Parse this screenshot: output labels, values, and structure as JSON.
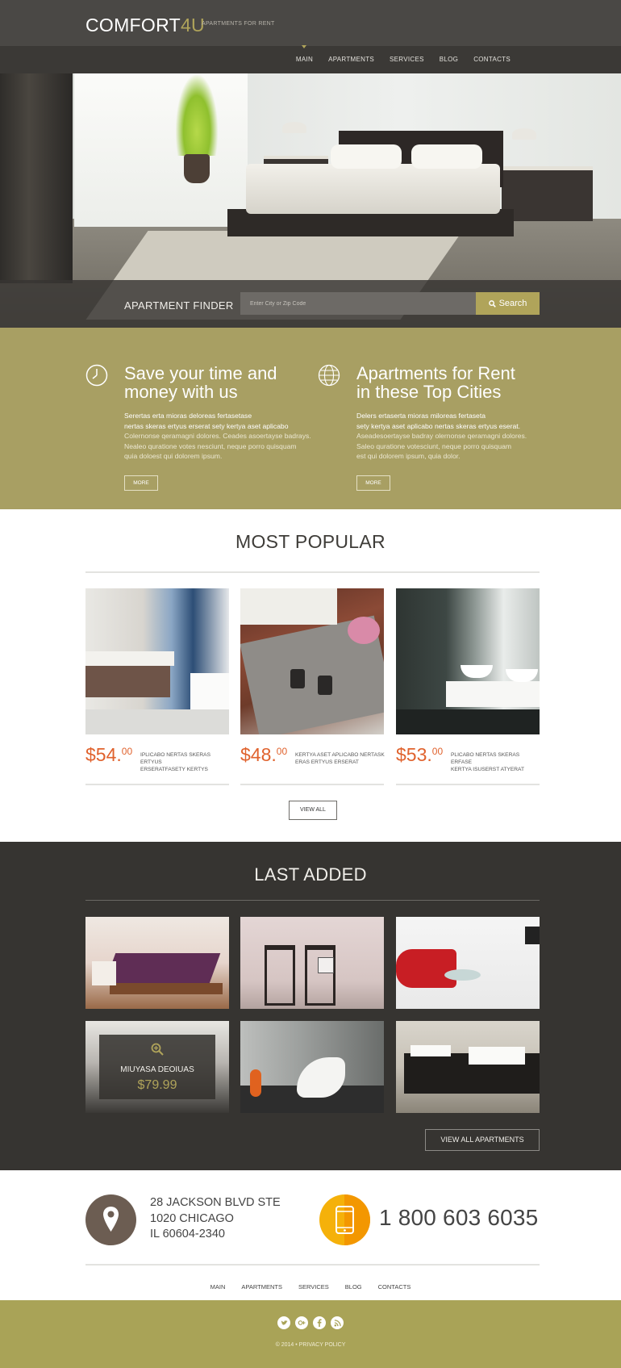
{
  "header": {
    "logo_main": "COMFORT",
    "logo_accent": "4U",
    "tagline": "APARTMENTS FOR RENT",
    "nav": [
      "MAIN",
      "APARTMENTS",
      "SERVICES",
      "BLOG",
      "CONTACTS"
    ],
    "active_nav": "MAIN"
  },
  "hero": {
    "finder_label": "APARTMENT FINDER",
    "finder_placeholder": "Enter City or Zip Code",
    "search_button": "Search",
    "slide_count": 3,
    "active_slide": 1
  },
  "features": [
    {
      "icon": "clock-icon",
      "title_line1": "Save your time and",
      "title_line2": "money with us",
      "lead_line1": "Serertas erta mioras deloreas fertasetase",
      "lead_line2": "nertas skeras ertyus erserat sety kertya aset aplicabo",
      "body_line1": "Colernonse qeramagni dolores. Ceades asoertayse badrays.",
      "body_line2": "Nealeo quratione votes nesciunt, neque porro quisquam",
      "body_line3": "quia doloest qui dolorem ipsum.",
      "button": "MORE"
    },
    {
      "icon": "globe-icon",
      "title_line1": "Apartments for Rent",
      "title_line2": "in these Top Cities",
      "lead_line1": "Delers ertaserta mioras miloreas fertaseta",
      "lead_line2": "sety kertya aset aplicabo nertas skeras ertyus eserat.",
      "body_line1": "Aseadesoertayse badray olernonse qeramagni dolores.",
      "body_line2": "Saleo quratione votesciunt, neque porro quisquam",
      "body_line3": "est qui dolorem ipsum, quia dolor.",
      "button": "MORE"
    }
  ],
  "popular": {
    "title": "MOST POPULAR",
    "items": [
      {
        "price_main": "$54.",
        "price_cents": "00",
        "desc_line1": "IPLICABO NERTAS SKERAS ERTYUS",
        "desc_line2": "ERSERATFASETY KERTYS"
      },
      {
        "price_main": "$48.",
        "price_cents": "00",
        "desc_line1": "KERTYA ASET APLICABO NERTASK",
        "desc_line2": "ERAS ERTYUS ERSERAT"
      },
      {
        "price_main": "$53.",
        "price_cents": "00",
        "desc_line1": "PLICABO NERTAS SKERAS ERFASE",
        "desc_line2": "KERTYA ISUSERST ATYERAT"
      }
    ],
    "view_all": "VIEW ALL"
  },
  "last_added": {
    "title": "LAST ADDED",
    "hover_item": {
      "name": "MIUYASA DEOIUAS",
      "price": "$79.99"
    },
    "view_all": "VIEW ALL APARTMENTS"
  },
  "contact": {
    "address_line1": "28 JACKSON BLVD STE",
    "address_line2": "1020 CHICAGO",
    "address_line3": "IL 60604-2340",
    "phone": "1 800 603 6035"
  },
  "footer": {
    "nav": [
      "MAIN",
      "APARTMENTS",
      "SERVICES",
      "BLOG",
      "CONTACTS"
    ],
    "socials": [
      "twitter-icon",
      "google-plus-icon",
      "facebook-icon",
      "rss-icon"
    ],
    "copyright": "© 2014",
    "separator": "•",
    "privacy": "PRIVACY POLICY"
  },
  "colors": {
    "accent": "#b0a45a",
    "price": "#e0622d",
    "dark": "#363431",
    "phone_circle": "#f5b10a"
  }
}
